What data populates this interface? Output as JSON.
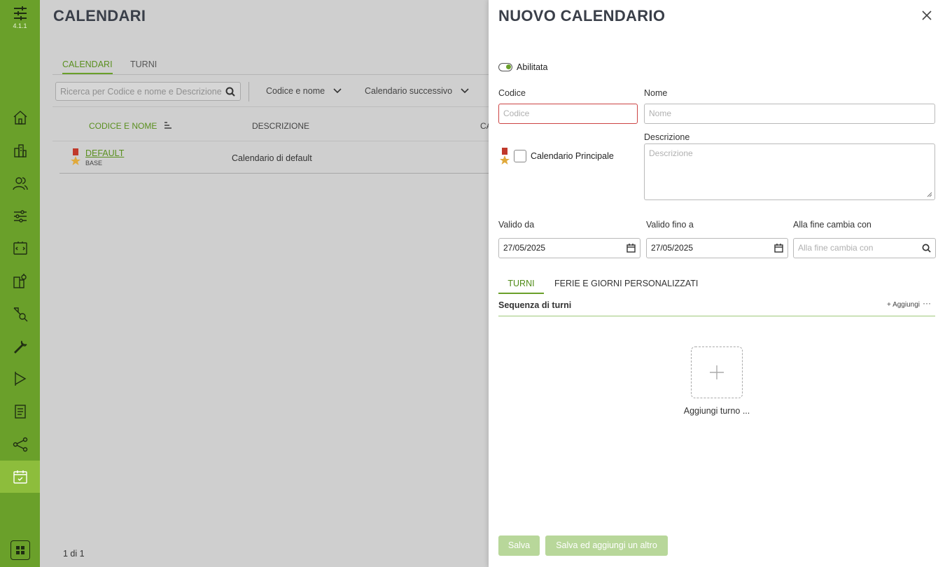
{
  "app": {
    "version": "4.1.1",
    "colors": {
      "accent": "#6aa02a",
      "accent_light": "#8dbd3c",
      "error": "#c44444"
    }
  },
  "sidebar": {
    "items": [
      {
        "icon": "home-icon"
      },
      {
        "icon": "building-icon"
      },
      {
        "icon": "users-icon"
      },
      {
        "icon": "sliders-icon"
      },
      {
        "icon": "screen-icon"
      },
      {
        "icon": "devices-icon"
      },
      {
        "icon": "flow-icon"
      },
      {
        "icon": "wrench-icon"
      },
      {
        "icon": "flag-icon"
      },
      {
        "icon": "document-icon"
      },
      {
        "icon": "share-icon"
      },
      {
        "icon": "calendar-icon",
        "active": true
      }
    ]
  },
  "page": {
    "title": "CALENDARI",
    "tabs": [
      {
        "label": "CALENDARI",
        "active": true
      },
      {
        "label": "TURNI",
        "active": false
      }
    ],
    "search": {
      "placeholder": "Ricerca per Codice e nome e Descrizione"
    },
    "filters": [
      {
        "label": "Codice e nome"
      },
      {
        "label": "Calendario successivo"
      }
    ],
    "table": {
      "columns": [
        "CODICE E NOME",
        "DESCRIZIONE",
        "CA"
      ],
      "rows": [
        {
          "code": "DEFAULT",
          "sub": "BASE",
          "description": "Calendario di default"
        }
      ]
    },
    "pager": "1 di 1"
  },
  "drawer": {
    "title": "NUOVO CALENDARIO",
    "enabled": {
      "label": "Abilitata",
      "on": true
    },
    "codice": {
      "label": "Codice",
      "placeholder": "Codice",
      "value": ""
    },
    "nome": {
      "label": "Nome",
      "placeholder": "Nome",
      "value": ""
    },
    "principale": {
      "label": "Calendario Principale",
      "checked": false
    },
    "descrizione": {
      "label": "Descrizione",
      "placeholder": "Descrizione"
    },
    "valido_da": {
      "label": "Valido da",
      "value": "27/05/2025"
    },
    "valido_fino": {
      "label": "Valido fino a",
      "value": "27/05/2025"
    },
    "alla_fine": {
      "label": "Alla fine cambia con",
      "placeholder": "Alla fine cambia con"
    },
    "subtabs": [
      {
        "label": "TURNI",
        "active": true
      },
      {
        "label": "FERIE E GIORNI PERSONALIZZATI",
        "active": false
      }
    ],
    "sequence": {
      "title": "Sequenza di turni",
      "add_label": "Aggiungi",
      "more": "···"
    },
    "add_shift": {
      "label": "Aggiungi turno ..."
    },
    "buttons": {
      "save": "Salva",
      "save_add": "Salva ed aggiungi un altro"
    }
  }
}
